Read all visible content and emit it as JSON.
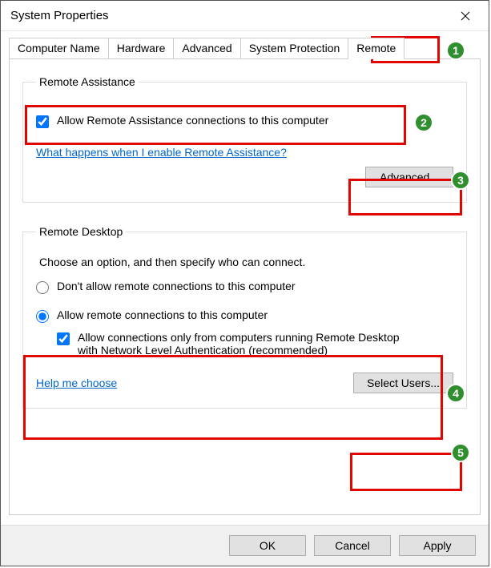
{
  "window": {
    "title": "System Properties"
  },
  "tabs": {
    "computer_name": "Computer Name",
    "hardware": "Hardware",
    "advanced": "Advanced",
    "system_protection": "System Protection",
    "remote": "Remote"
  },
  "remote_assistance": {
    "legend": "Remote Assistance",
    "allow_label": "Allow Remote Assistance connections to this computer",
    "allow_checked": true,
    "help_link": "What happens when I enable Remote Assistance?",
    "advanced_btn": "Advanced..."
  },
  "remote_desktop": {
    "legend": "Remote Desktop",
    "choose_text": "Choose an option, and then specify who can connect.",
    "opt_deny": "Don't allow remote connections to this computer",
    "opt_allow": "Allow remote connections to this computer",
    "selected": "allow",
    "nla_label": "Allow connections only from computers running Remote Desktop with Network Level Authentication (recommended)",
    "nla_checked": true,
    "help_link": "Help me choose",
    "select_users_btn": "Select Users..."
  },
  "footer": {
    "ok": "OK",
    "cancel": "Cancel",
    "apply": "Apply"
  },
  "annotations": {
    "b1": "1",
    "b2": "2",
    "b3": "3",
    "b4": "4",
    "b5": "5"
  }
}
